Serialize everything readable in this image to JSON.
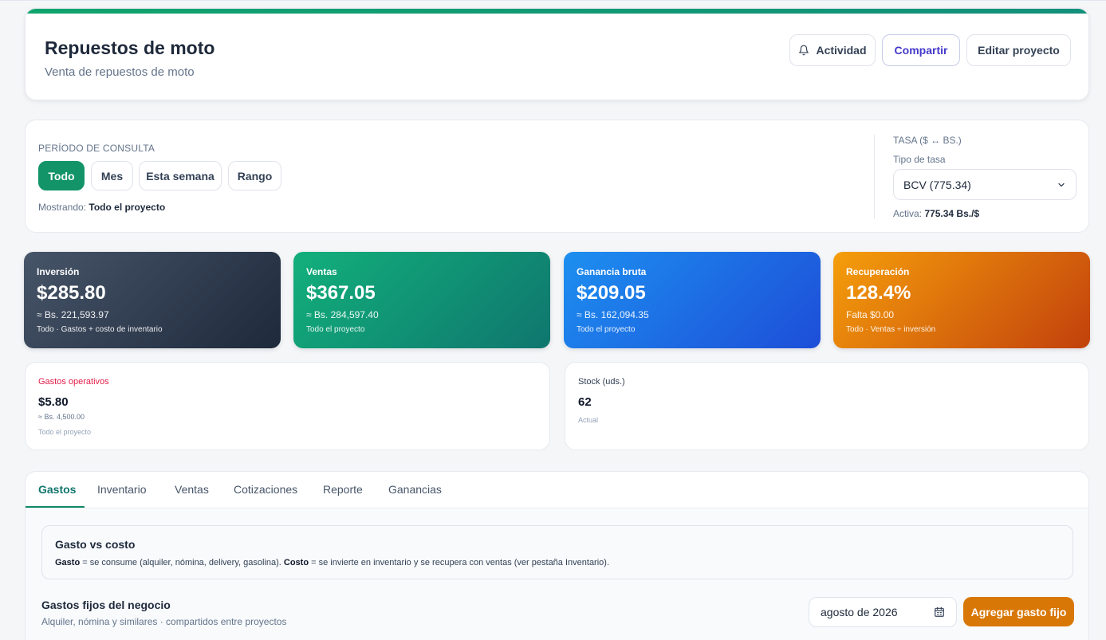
{
  "header": {
    "title": "Repuestos de moto",
    "subtitle": "Venta de repuestos de moto",
    "activity_label": "Actividad",
    "share_label": "Compartir",
    "edit_label": "Editar proyecto",
    "accent_color": "#10a46d"
  },
  "period": {
    "label": "PERÍODO DE CONSULTA",
    "options": [
      "Todo",
      "Mes",
      "Esta semana",
      "Rango"
    ],
    "selected": "Todo",
    "showing_prefix": "Mostrando:",
    "showing_value": "Todo el proyecto"
  },
  "rate": {
    "label": "TASA ($ ↔ BS.)",
    "type_label": "Tipo de tasa",
    "selected": "BCV (775.34)",
    "active_prefix": "Activa:",
    "active_value": "775.34 Bs./$"
  },
  "kpis": [
    {
      "label": "Inversión",
      "value": "$285.80",
      "sub": "≈ Bs. 221,593.97",
      "note": "Todo · Gastos + costo de inventario"
    },
    {
      "label": "Ventas",
      "value": "$367.05",
      "sub": "≈ Bs. 284,597.40",
      "note": "Todo el proyecto"
    },
    {
      "label": "Ganancia bruta",
      "value": "$209.05",
      "sub": "≈ Bs. 162,094.35",
      "note": "Todo el proyecto"
    },
    {
      "label": "Recuperación",
      "value": "128.4%",
      "sub": "Falta $0.00",
      "note": "Todo · Ventas ÷ inversión"
    }
  ],
  "stats": {
    "expenses": {
      "label": "Gastos operativos",
      "value": "$5.80",
      "sub": "≈ Bs. 4,500.00",
      "note": "Todo el proyecto"
    },
    "stock": {
      "label": "Stock (uds.)",
      "value": "62",
      "note": "Actual"
    }
  },
  "tabs": [
    "Gastos",
    "Inventario",
    "Ventas",
    "Cotizaciones",
    "Reporte",
    "Ganancias"
  ],
  "active_tab": "Gastos",
  "info": {
    "title": "Gasto vs costo",
    "gasto_word": "Gasto",
    "gasto_text": " = se consume (alquiler, nómina, delivery, gasolina). ",
    "costo_word": "Costo",
    "costo_text": " = se invierte en inventario y se recupera con ventas (ver pestaña Inventario)."
  },
  "fixed_expenses": {
    "title": "Gastos fijos del negocio",
    "subtitle": "Alquiler, nómina y similares · compartidos entre proyectos",
    "month_value": "agosto de 2026",
    "add_label": "Agregar gasto fijo"
  }
}
